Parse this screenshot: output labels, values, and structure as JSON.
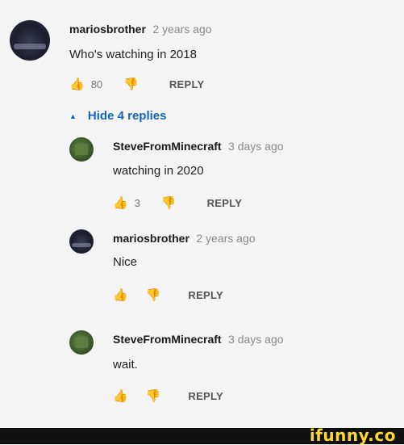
{
  "comments": [
    {
      "author": "mariosbrother",
      "time": "2 years ago",
      "text": "Who's watching in 2018",
      "likes": "80",
      "reply_label": "REPLY"
    }
  ],
  "replies_toggle": {
    "label": "Hide 4 replies"
  },
  "replies": [
    {
      "author": "SteveFromMinecraft",
      "time": "3 days ago",
      "text": "watching in 2020",
      "likes": "3",
      "reply_label": "REPLY"
    },
    {
      "author": "mariosbrother",
      "time": "2 years ago",
      "text": "Nice",
      "likes": "",
      "reply_label": "REPLY"
    },
    {
      "author": "SteveFromMinecraft",
      "time": "3 days ago",
      "text": "wait.",
      "likes": "",
      "reply_label": "REPLY"
    }
  ],
  "watermark": "ifunny.co",
  "icons": {
    "like": "thumbs-up-icon",
    "dislike": "thumbs-down-icon",
    "collapse": "caret-up-icon"
  }
}
